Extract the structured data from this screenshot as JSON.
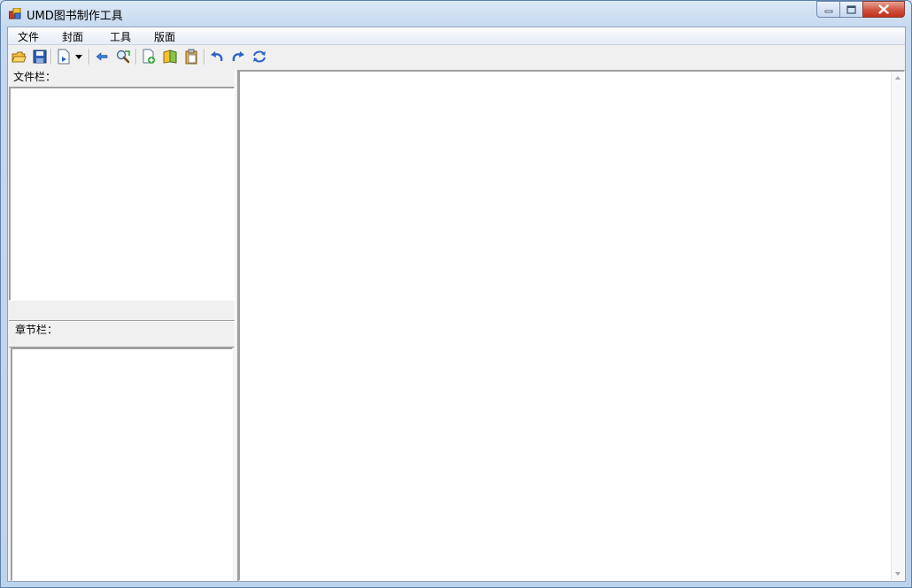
{
  "window": {
    "title": "UMD图书制作工具"
  },
  "menu": {
    "items": [
      "文件",
      "封面",
      "工具",
      "版面"
    ]
  },
  "toolbar": {
    "icons": [
      "open-folder-icon",
      "save-icon",
      "new-page-dropdown-icon",
      "dropdown-arrow-icon",
      "back-arrow-icon",
      "find-replace-icon",
      "add-file-icon",
      "library-icon",
      "paste-icon",
      "undo-icon",
      "redo-icon",
      "refresh-icon"
    ]
  },
  "panels": {
    "file_label": "文件栏：",
    "chapter_label": "章节栏："
  }
}
